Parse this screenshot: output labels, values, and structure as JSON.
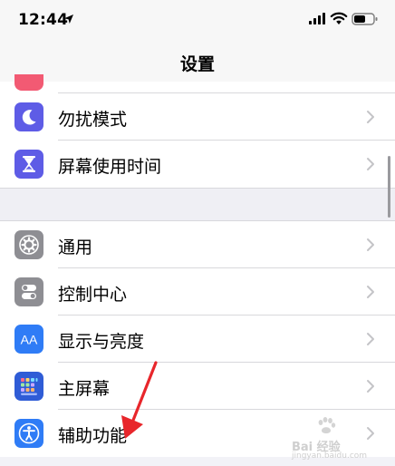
{
  "status_bar": {
    "time": "12:44",
    "icons": [
      "location-arrow-icon",
      "signal-icon",
      "wifi-icon",
      "battery-icon"
    ]
  },
  "nav": {
    "title": "设置"
  },
  "rows": [
    {
      "label": "勿扰模式",
      "icon": "moon-icon",
      "color": "#5e5ce6"
    },
    {
      "label": "屏幕使用时间",
      "icon": "hourglass-icon",
      "color": "#5e5ce6"
    },
    {
      "label": "通用",
      "icon": "gear-icon",
      "color": "#8e8e93"
    },
    {
      "label": "控制中心",
      "icon": "toggles-icon",
      "color": "#8e8e93"
    },
    {
      "label": "显示与亮度",
      "icon": "aa-icon",
      "color": "#2f7cf6"
    },
    {
      "label": "主屏幕",
      "icon": "home-grid-icon",
      "color": "#2f5cd6"
    },
    {
      "label": "辅助功能",
      "icon": "accessibility-icon",
      "color": "#2f7cf6"
    }
  ],
  "icons_text": {
    "aa": "AA"
  },
  "annotation": {
    "arrow_color": "#e8262b"
  },
  "watermark": {
    "brand": "Bai 经验",
    "url": "jingyan.baidu.com"
  }
}
